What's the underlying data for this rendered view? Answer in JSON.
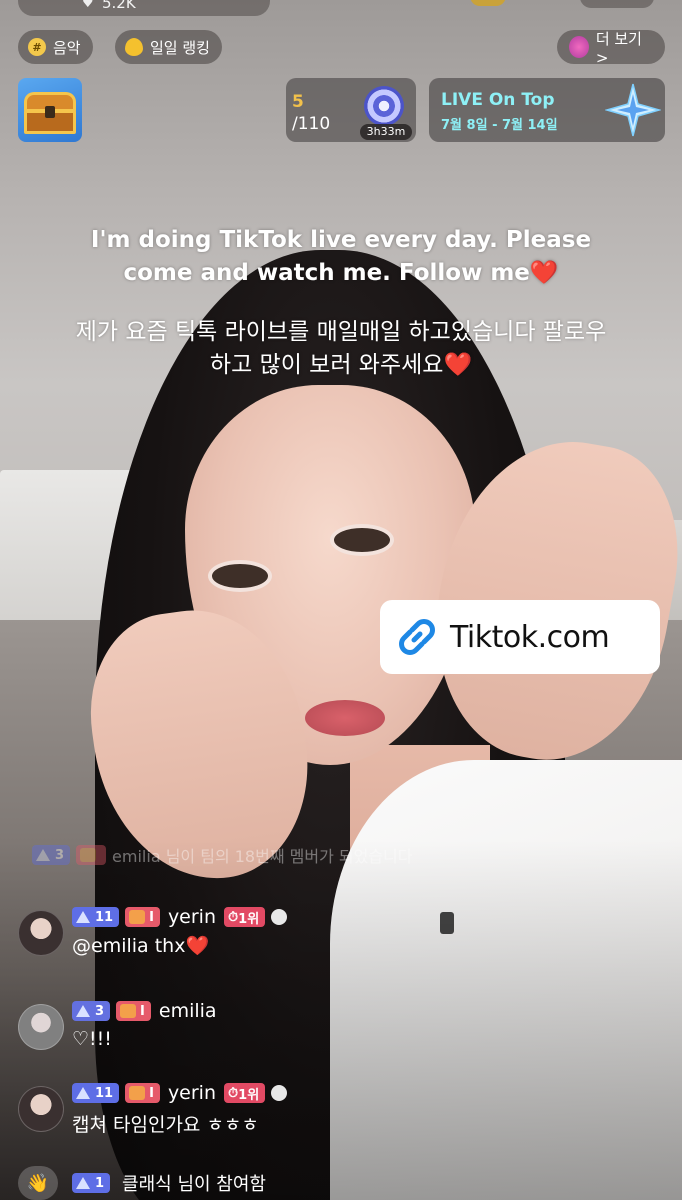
{
  "top_bar": {
    "viewer_count": "5.2K"
  },
  "chips": {
    "music_label": "음악",
    "ranking_label": "일일 랭킹",
    "more_label": "더 보기 >"
  },
  "goal": {
    "current": "5",
    "total": "/110",
    "timer": "3h33m"
  },
  "live_on_top": {
    "title": "LIVE On Top",
    "dates": "7월 8일 - 7월 14일"
  },
  "overlay": {
    "english_line1": "I'm doing TikTok live every day. Please",
    "english_line2": "come and watch me. Follow me❤️",
    "korean_line1": "제가 요즘 틱톡 라이브를 매일매일 하고있습니다 팔로우",
    "korean_line2": "하고 많이 보러 와주세요❤️"
  },
  "link_sticker": {
    "label": "Tiktok.com"
  },
  "chat": {
    "system_faded": {
      "level": "3",
      "text": "emilia 님이 팀의 18번째 멤버가 되었습니다"
    },
    "messages": [
      {
        "level": "11",
        "fan": "I",
        "user": "yerin",
        "rank": "1위",
        "text": "@emilia thx❤️"
      },
      {
        "level": "3",
        "fan": "I",
        "user": "emilia",
        "rank": "",
        "text": "♡!!!"
      },
      {
        "level": "11",
        "fan": "I",
        "user": "yerin",
        "rank": "1위",
        "text": "캡쳐 타임인가요 ㅎㅎㅎ"
      }
    ],
    "join": {
      "level": "1",
      "text": "클래식 님이 참여함"
    }
  }
}
